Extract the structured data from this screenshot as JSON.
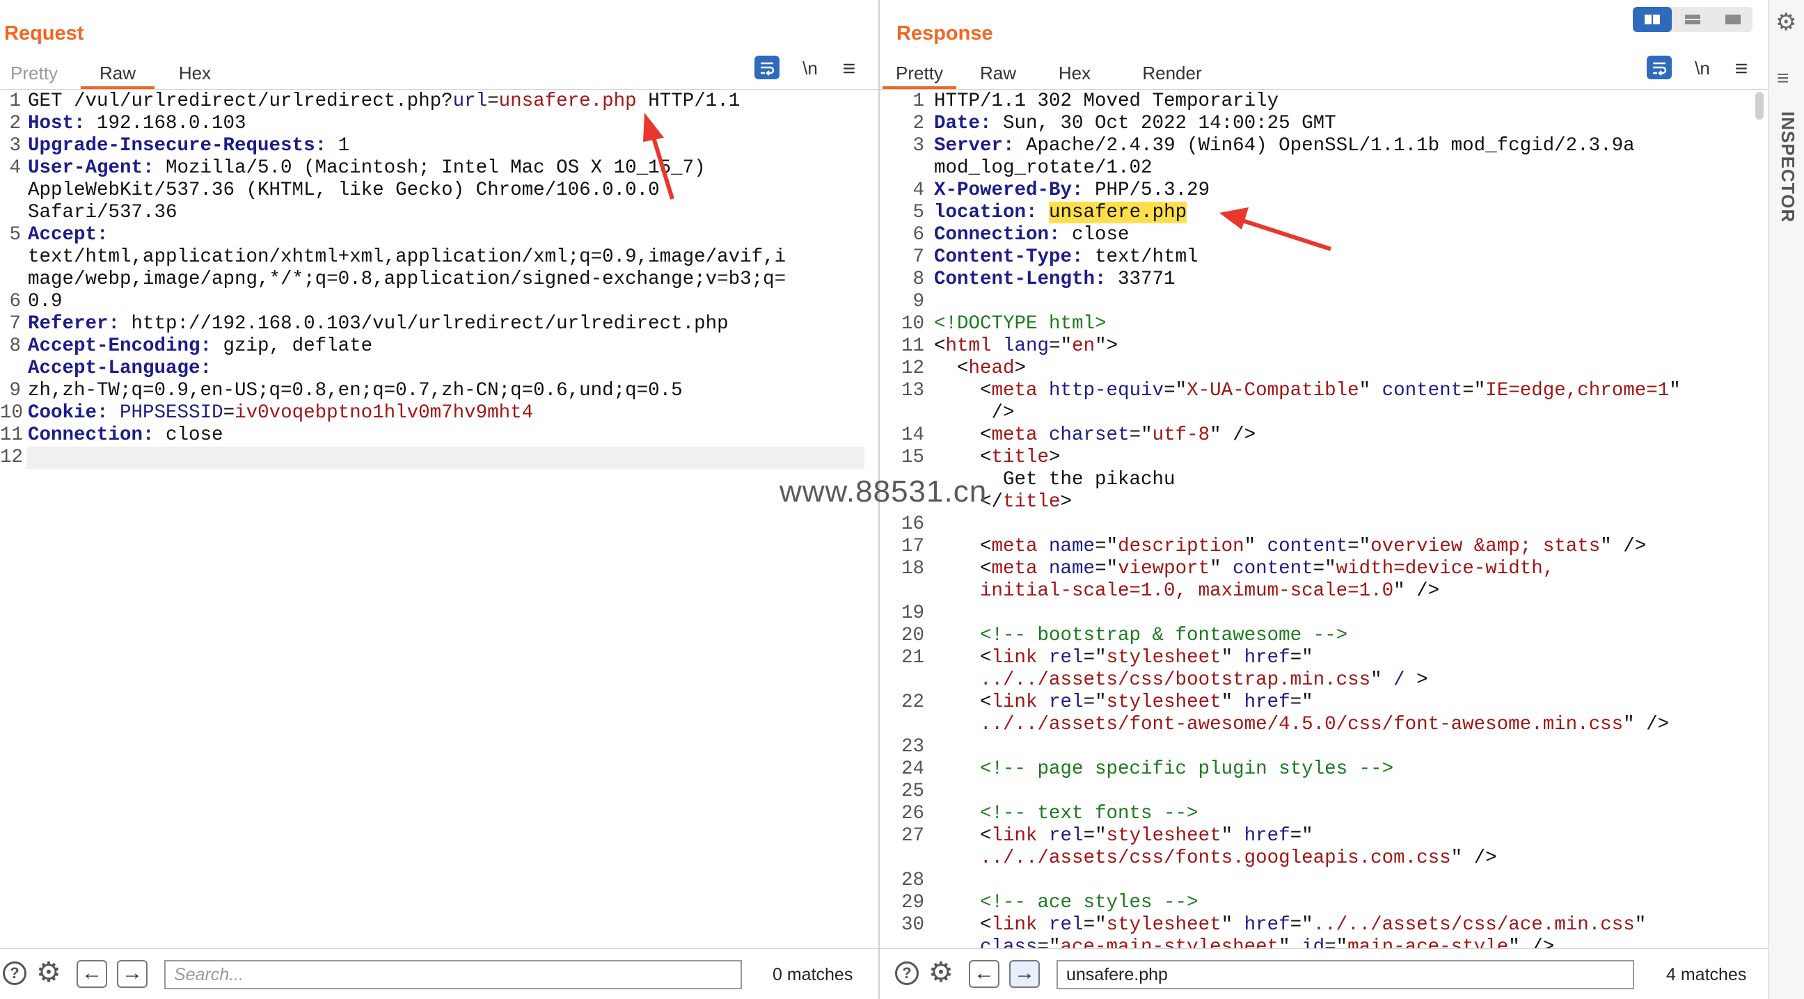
{
  "request": {
    "title": "Request",
    "tabs": [
      "Pretty",
      "Raw",
      "Hex"
    ],
    "active_tab": "Raw",
    "newline_label": "\\n",
    "menu_glyph": "≡",
    "line_numbers": [
      "1",
      "2",
      "3",
      "4",
      "",
      "",
      "5",
      "",
      "",
      "6",
      "7",
      "8",
      "",
      "9",
      "10",
      "11",
      "12"
    ],
    "lines": [
      [
        {
          "t": "GET /vul/urlredirect/urlredirect.php?"
        },
        {
          "t": "url",
          "c": "hn"
        },
        {
          "t": "="
        },
        {
          "t": "unsafere.php",
          "c": "tag"
        },
        {
          "t": " HTTP/1.1"
        }
      ],
      [
        {
          "t": "Host:",
          "c": "k"
        },
        {
          "t": " 192.168.0.103"
        }
      ],
      [
        {
          "t": "Upgrade-Insecure-Requests:",
          "c": "k"
        },
        {
          "t": " 1"
        }
      ],
      [
        {
          "t": "User-Agent:",
          "c": "k"
        },
        {
          "t": " Mozilla/5.0 (Macintosh; Intel Mac OS X 10_15_7)"
        }
      ],
      [
        {
          "t": "AppleWebKit/537.36 (KHTML, like Gecko) Chrome/106.0.0.0"
        }
      ],
      [
        {
          "t": "Safari/537.36"
        }
      ],
      [
        {
          "t": "Accept:",
          "c": "k"
        }
      ],
      [
        {
          "t": "text/html,application/xhtml+xml,application/xml;q=0.9,image/avif,i"
        }
      ],
      [
        {
          "t": "mage/webp,image/apng,*/*;q=0.8,application/signed-exchange;v=b3;q="
        }
      ],
      [
        {
          "t": "0.9"
        }
      ],
      [
        {
          "t": "Referer:",
          "c": "k"
        },
        {
          "t": " http://192.168.0.103/vul/urlredirect/urlredirect.php"
        }
      ],
      [
        {
          "t": "Accept-Encoding:",
          "c": "k"
        },
        {
          "t": " gzip, deflate"
        }
      ],
      [
        {
          "t": "Accept-Language:",
          "c": "k"
        }
      ],
      [
        {
          "t": "zh,zh-TW;q=0.9,en-US;q=0.8,en;q=0.7,zh-CN;q=0.6,und;q=0.5"
        }
      ],
      [
        {
          "t": "Cookie:",
          "c": "k"
        },
        {
          "t": " "
        },
        {
          "t": "PHPSESSID",
          "c": "hn"
        },
        {
          "t": "="
        },
        {
          "t": "iv0voqebptno1hlv0m7hv9mht4",
          "c": "tag"
        }
      ],
      [
        {
          "t": "Connection:",
          "c": "k"
        },
        {
          "t": " close"
        }
      ],
      [
        {
          "t": ""
        }
      ],
      [
        {
          "t": ""
        }
      ]
    ],
    "search": {
      "placeholder": "Search...",
      "value": "",
      "matches": "0 matches"
    }
  },
  "response": {
    "title": "Response",
    "tabs": [
      "Pretty",
      "Raw",
      "Hex",
      "Render"
    ],
    "active_tab": "Pretty",
    "newline_label": "\\n",
    "menu_glyph": "≡",
    "line_numbers": [
      "1",
      "2",
      "3",
      "",
      "4",
      "5",
      "6",
      "7",
      "8",
      "9",
      "10",
      "11",
      "12",
      "13",
      "",
      "14",
      "15",
      "",
      "",
      "16",
      "17",
      "18",
      "",
      "19",
      "20",
      "21",
      "",
      "22",
      "",
      "23",
      "24",
      "25",
      "26",
      "27",
      "",
      "28",
      "29",
      "30",
      ""
    ],
    "lines": [
      [
        {
          "t": "HTTP/1.1 302 Moved Temporarily"
        }
      ],
      [
        {
          "t": "Date:",
          "c": "k"
        },
        {
          "t": " Sun, 30 Oct 2022 14:00:25 GMT"
        }
      ],
      [
        {
          "t": "Server:",
          "c": "k"
        },
        {
          "t": " Apache/2.4.39 (Win64) OpenSSL/1.1.1b mod_fcgid/2.3.9a"
        }
      ],
      [
        {
          "t": "mod_log_rotate/1.02"
        }
      ],
      [
        {
          "t": "X-Powered-By:",
          "c": "k"
        },
        {
          "t": " PHP/5.3.29"
        }
      ],
      [
        {
          "t": "location:",
          "c": "k"
        },
        {
          "t": " "
        },
        {
          "t": "unsafere.php",
          "c": "hl"
        }
      ],
      [
        {
          "t": "Connection:",
          "c": "k"
        },
        {
          "t": " close"
        }
      ],
      [
        {
          "t": "Content-Type:",
          "c": "k"
        },
        {
          "t": " text/html"
        }
      ],
      [
        {
          "t": "Content-Length:",
          "c": "k"
        },
        {
          "t": " 33771"
        }
      ],
      [
        {
          "t": ""
        }
      ],
      [
        {
          "t": "<!DOCTYPE html>",
          "c": "cm"
        }
      ],
      [
        {
          "t": "<"
        },
        {
          "t": "html",
          "c": "tag"
        },
        {
          "t": " "
        },
        {
          "t": "lang",
          "c": "an"
        },
        {
          "t": "=\""
        },
        {
          "t": "en",
          "c": "av"
        },
        {
          "t": "\">"
        }
      ],
      [
        {
          "t": "  <"
        },
        {
          "t": "head",
          "c": "tag"
        },
        {
          "t": ">"
        }
      ],
      [
        {
          "t": "    <"
        },
        {
          "t": "meta",
          "c": "tag"
        },
        {
          "t": " "
        },
        {
          "t": "http-equiv",
          "c": "an"
        },
        {
          "t": "=\""
        },
        {
          "t": "X-UA-Compatible",
          "c": "av"
        },
        {
          "t": "\" "
        },
        {
          "t": "content",
          "c": "an"
        },
        {
          "t": "=\""
        },
        {
          "t": "IE=edge,chrome=1",
          "c": "av"
        },
        {
          "t": "\""
        }
      ],
      [
        {
          "t": "     />"
        }
      ],
      [
        {
          "t": "    <"
        },
        {
          "t": "meta",
          "c": "tag"
        },
        {
          "t": " "
        },
        {
          "t": "charset",
          "c": "an"
        },
        {
          "t": "=\""
        },
        {
          "t": "utf-8",
          "c": "av"
        },
        {
          "t": "\" />"
        }
      ],
      [
        {
          "t": "    <"
        },
        {
          "t": "title",
          "c": "tag"
        },
        {
          "t": ">"
        }
      ],
      [
        {
          "t": "      Get the pikachu"
        }
      ],
      [
        {
          "t": "    </"
        },
        {
          "t": "title",
          "c": "tag"
        },
        {
          "t": ">"
        }
      ],
      [
        {
          "t": ""
        }
      ],
      [
        {
          "t": "    <"
        },
        {
          "t": "meta",
          "c": "tag"
        },
        {
          "t": " "
        },
        {
          "t": "name",
          "c": "an"
        },
        {
          "t": "=\""
        },
        {
          "t": "description",
          "c": "av"
        },
        {
          "t": "\" "
        },
        {
          "t": "content",
          "c": "an"
        },
        {
          "t": "=\""
        },
        {
          "t": "overview &amp; stats",
          "c": "av"
        },
        {
          "t": "\" />"
        }
      ],
      [
        {
          "t": "    <"
        },
        {
          "t": "meta",
          "c": "tag"
        },
        {
          "t": " "
        },
        {
          "t": "name",
          "c": "an"
        },
        {
          "t": "=\""
        },
        {
          "t": "viewport",
          "c": "av"
        },
        {
          "t": "\" "
        },
        {
          "t": "content",
          "c": "an"
        },
        {
          "t": "=\""
        },
        {
          "t": "width=device-width,",
          "c": "av"
        }
      ],
      [
        {
          "t": "    "
        },
        {
          "t": "initial-scale=1.0, maximum-scale=1.0",
          "c": "av"
        },
        {
          "t": "\" />"
        }
      ],
      [
        {
          "t": ""
        }
      ],
      [
        {
          "t": "    <!-- bootstrap & fontawesome -->",
          "c": "cm"
        }
      ],
      [
        {
          "t": "    <"
        },
        {
          "t": "link",
          "c": "tag"
        },
        {
          "t": " "
        },
        {
          "t": "rel",
          "c": "an"
        },
        {
          "t": "=\""
        },
        {
          "t": "stylesheet",
          "c": "av"
        },
        {
          "t": "\" "
        },
        {
          "t": "href",
          "c": "an"
        },
        {
          "t": "=\""
        }
      ],
      [
        {
          "t": "    "
        },
        {
          "t": "../../assets/css/bootstrap.min.css",
          "c": "av"
        },
        {
          "t": "\" "
        },
        {
          "t": "/",
          "c": "hn"
        },
        {
          "t": " >"
        }
      ],
      [
        {
          "t": "    <"
        },
        {
          "t": "link",
          "c": "tag"
        },
        {
          "t": " "
        },
        {
          "t": "rel",
          "c": "an"
        },
        {
          "t": "=\""
        },
        {
          "t": "stylesheet",
          "c": "av"
        },
        {
          "t": "\" "
        },
        {
          "t": "href",
          "c": "an"
        },
        {
          "t": "=\""
        }
      ],
      [
        {
          "t": "    "
        },
        {
          "t": "../../assets/font-awesome/4.5.0/css/font-awesome.min.css",
          "c": "av"
        },
        {
          "t": "\" />"
        }
      ],
      [
        {
          "t": ""
        }
      ],
      [
        {
          "t": "    <!-- page specific plugin styles -->",
          "c": "cm"
        }
      ],
      [
        {
          "t": ""
        }
      ],
      [
        {
          "t": "    <!-- text fonts -->",
          "c": "cm"
        }
      ],
      [
        {
          "t": "    <"
        },
        {
          "t": "link",
          "c": "tag"
        },
        {
          "t": " "
        },
        {
          "t": "rel",
          "c": "an"
        },
        {
          "t": "=\""
        },
        {
          "t": "stylesheet",
          "c": "av"
        },
        {
          "t": "\" "
        },
        {
          "t": "href",
          "c": "an"
        },
        {
          "t": "=\""
        }
      ],
      [
        {
          "t": "    "
        },
        {
          "t": "../../assets/css/fonts.googleapis.com.css",
          "c": "av"
        },
        {
          "t": "\" />"
        }
      ],
      [
        {
          "t": ""
        }
      ],
      [
        {
          "t": "    <!-- ace styles -->",
          "c": "cm"
        }
      ],
      [
        {
          "t": "    <"
        },
        {
          "t": "link",
          "c": "tag"
        },
        {
          "t": " "
        },
        {
          "t": "rel",
          "c": "an"
        },
        {
          "t": "=\""
        },
        {
          "t": "stylesheet",
          "c": "av"
        },
        {
          "t": "\" "
        },
        {
          "t": "href",
          "c": "an"
        },
        {
          "t": "=\""
        },
        {
          "t": "../../assets/css/ace.min.css",
          "c": "av"
        },
        {
          "t": "\""
        }
      ],
      [
        {
          "t": "    "
        },
        {
          "t": "class",
          "c": "an"
        },
        {
          "t": "=\""
        },
        {
          "t": "ace-main-stylesheet",
          "c": "av"
        },
        {
          "t": "\" "
        },
        {
          "t": "id",
          "c": "an"
        },
        {
          "t": "=\""
        },
        {
          "t": "main-ace-style",
          "c": "av"
        },
        {
          "t": "\" />"
        }
      ]
    ],
    "search": {
      "placeholder": "Search...",
      "value": "unsafere.php",
      "matches": "4 matches"
    }
  },
  "sidebar": {
    "label": "INSPECTOR"
  },
  "watermark": "www.88531.cn",
  "colors": {
    "accent": "#f26522",
    "header_key": "#1c1c8c",
    "string": "#a31515",
    "comment": "#1d7a1d",
    "highlight": "#ffe04a",
    "button_blue": "#2f6bbd",
    "annotation_arrow": "#e8372c"
  }
}
